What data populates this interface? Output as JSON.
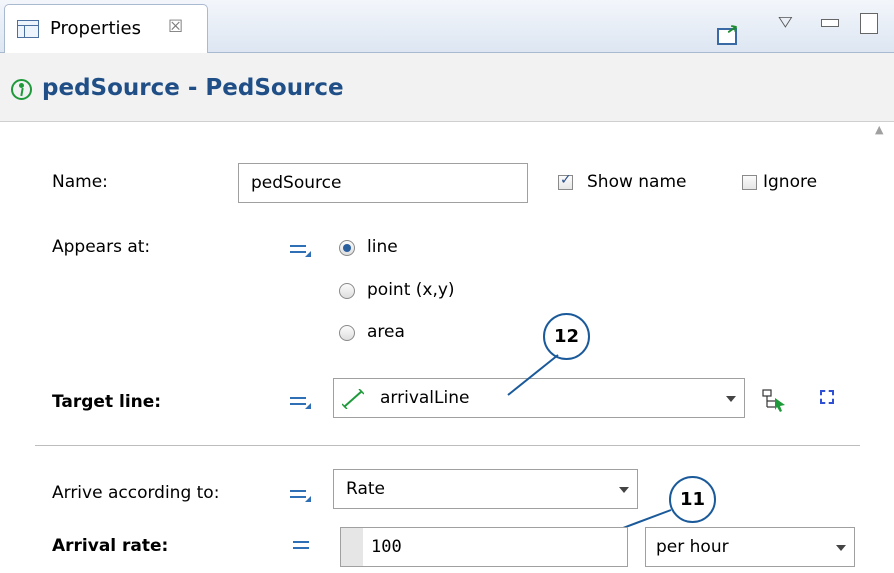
{
  "tab": {
    "label": "Properties",
    "close": "☒"
  },
  "title": "pedSource - PedSource",
  "form": {
    "name_label": "Name:",
    "name_value": "pedSource",
    "show_name": "Show name",
    "ignore": "Ignore",
    "appears_label": "Appears at:",
    "opt_line": "line",
    "opt_point": "point (x,y)",
    "opt_area": "area",
    "target_label": "Target line:",
    "target_value": "arrivalLine",
    "arrive_label": "Arrive according to:",
    "arrive_value": "Rate",
    "rate_label": "Arrival rate:",
    "rate_value": "100",
    "rate_unit": "per hour"
  },
  "callouts": {
    "a": "12",
    "b": "11"
  },
  "colors": {
    "title": "#1f4f86",
    "accent": "#2f6fb5",
    "callout_border": "#1a5a9a"
  },
  "icons": [
    "table-icon",
    "close-icon",
    "export-icon",
    "view-menu-icon",
    "minimize-icon",
    "maximize-icon",
    "pedestrian-icon",
    "equals-icon",
    "line-icon",
    "select-target-icon",
    "marquee-icon"
  ]
}
